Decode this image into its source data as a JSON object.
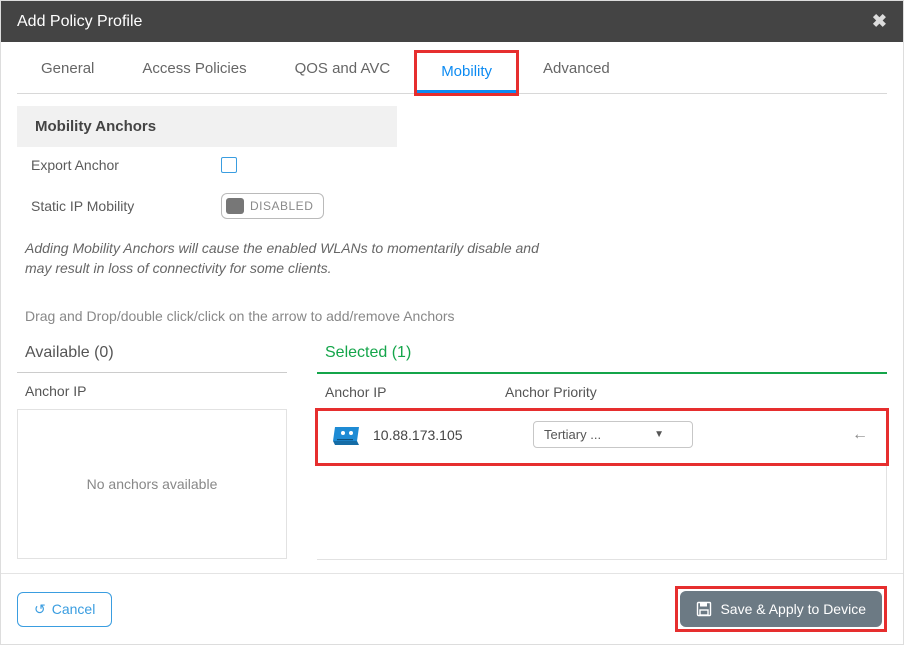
{
  "header": {
    "title": "Add Policy Profile"
  },
  "tabs": {
    "general": "General",
    "access_policies": "Access Policies",
    "qos_avc": "QOS and AVC",
    "mobility": "Mobility",
    "advanced": "Advanced",
    "active": "mobility"
  },
  "section": {
    "title": "Mobility Anchors",
    "export_anchor_label": "Export Anchor",
    "static_ip_label": "Static IP Mobility",
    "static_ip_state": "DISABLED",
    "warning": "Adding Mobility Anchors will cause the enabled WLANs to momentarily disable and may result in loss of connectivity for some clients.",
    "drag_hint": "Drag and Drop/double click/click on the arrow to add/remove Anchors"
  },
  "available": {
    "header": "Available (0)",
    "col_ip": "Anchor IP",
    "empty": "No anchors available"
  },
  "selected": {
    "header": "Selected (1)",
    "col_ip": "Anchor IP",
    "col_priority": "Anchor Priority",
    "rows": [
      {
        "ip": "10.88.173.105",
        "priority": "Tertiary ..."
      }
    ]
  },
  "footer": {
    "cancel": "Cancel",
    "save": "Save & Apply to Device"
  }
}
